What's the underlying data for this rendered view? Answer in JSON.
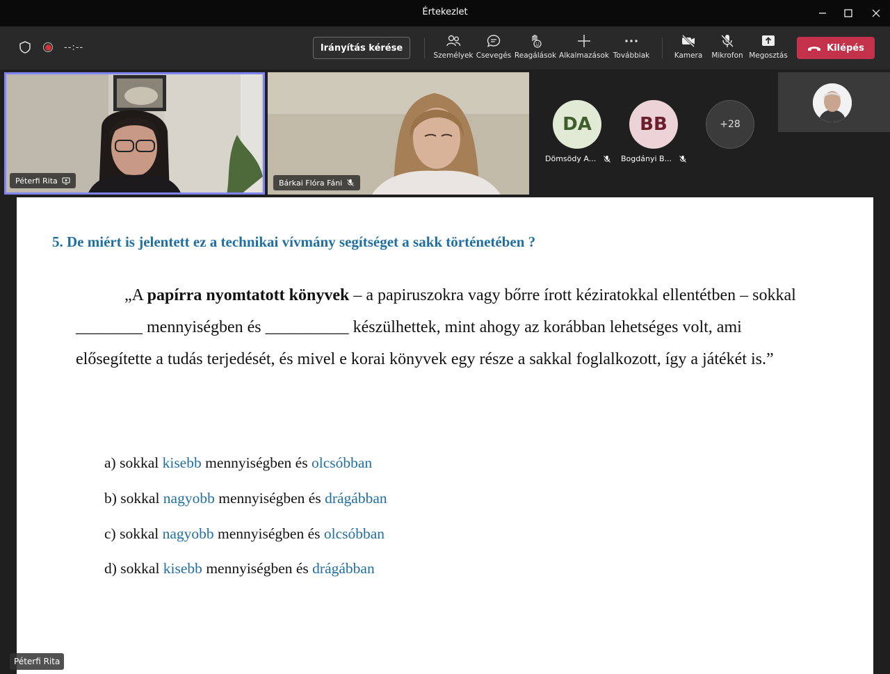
{
  "window": {
    "title": "Értekezlet"
  },
  "toolbar": {
    "timer": "--:--",
    "request_control": "Irányítás kérése",
    "tools": [
      {
        "id": "people",
        "label": "Személyek",
        "icon": "people-icon"
      },
      {
        "id": "chat",
        "label": "Csevegés",
        "icon": "chat-icon"
      },
      {
        "id": "react",
        "label": "Reagálások",
        "icon": "reaction-icon"
      },
      {
        "id": "apps",
        "label": "Alkalmazások",
        "icon": "plus-icon"
      },
      {
        "id": "more",
        "label": "Továbbiak",
        "icon": "more-icon"
      },
      {
        "id": "camera",
        "label": "Kamera",
        "icon": "camera-off-icon"
      },
      {
        "id": "mic",
        "label": "Mikrofon",
        "icon": "mic-off-icon"
      },
      {
        "id": "share",
        "label": "Megosztás",
        "icon": "share-icon"
      }
    ],
    "leave": "Kilépés"
  },
  "participants": {
    "video1_name": "Péterfi Rita",
    "video2_name": "Bárkai Flóra Fáni",
    "avatar1": {
      "initials": "DA",
      "name": "Dömsödy A..."
    },
    "avatar2": {
      "initials": "BB",
      "name": "Bogdányi B..."
    },
    "more_count": "+28"
  },
  "slide": {
    "question": "5. De miért is jelentett ez a technikai vívmány segítséget a sakk történetében ?",
    "quote_open": "„A ",
    "quote_bold": "papírra nyomtatott könyvek",
    "quote_rest": " – a papiruszokra vagy bőrre írott kéziratokkal ellentétben – sokkal ________ mennyiségben és __________ készülhettek, mint ahogy az korábban lehetséges volt, ami elősegítette a tudás terjedését, és mivel e korai könyvek egy része a sakkal foglalkozott, így a játékét is.”",
    "options": [
      {
        "prefix": "a) sokkal ",
        "w1": "kisebb",
        "mid": " mennyiségben és ",
        "w2": "olcsóbban"
      },
      {
        "prefix": "b) sokkal ",
        "w1": "nagyobb",
        "mid": " mennyiségben és ",
        "w2": "drágábban"
      },
      {
        "prefix": "c) sokkal ",
        "w1": "nagyobb",
        "mid": " mennyiségben és ",
        "w2": "olcsóbban"
      },
      {
        "prefix": "d) sokkal ",
        "w1": "kisebb",
        "mid": " mennyiségben és ",
        "w2": "drágábban"
      }
    ]
  },
  "presenter_name": "Péterfi Rita"
}
